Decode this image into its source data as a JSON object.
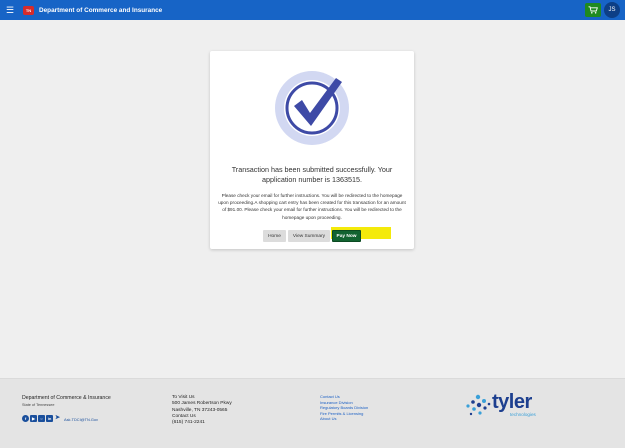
{
  "header": {
    "logo_text": "TN",
    "title": "Department of Commerce and Insurance",
    "user_initials": "JS",
    "icons": {
      "menu": "hamburger-menu-icon",
      "cart": "shopping-cart-icon"
    },
    "colors": {
      "bar": "#1764c6",
      "cart": "#1f8a1f",
      "avatar": "#0d3f86"
    }
  },
  "confirmation": {
    "icon": "checkmark-circle-icon",
    "message": "Transaction has been submitted successfully. Your application number is 1363515.",
    "details": "Please check your email for further instructions. You will be redirected to the homepage upon proceeding.A shopping cart entry has been created for this transaction for an amount of $91.00. Please check your email for further instructions. You will be redirected to the homepage upon proceeding.",
    "buttons": {
      "home": "Home",
      "view_summary": "View Summary",
      "pay_now": "Pay Now"
    }
  },
  "footer": {
    "org_name": "Department of Commerce & Insurance",
    "state": "State of Tennessee",
    "email": "Ask.TDCI@TN.Gov",
    "social_icons": [
      "facebook-icon",
      "youtube-icon",
      "instagram-icon",
      "linkedin-icon",
      "twitter-icon"
    ],
    "visit": {
      "label": "To Visit Us",
      "address1": "500 James Robertson Pkwy",
      "address2": "Nashville, TN 37243-0565",
      "contact_label": "Contact Us",
      "phone": "(615) 741-2241"
    },
    "links": [
      "Contact Us",
      "Insurance Division",
      "Regulatory Boards Division",
      "Fire Permits & Licensing",
      "About Us"
    ],
    "brand": {
      "name": "tyler",
      "sub": "technologies"
    }
  }
}
